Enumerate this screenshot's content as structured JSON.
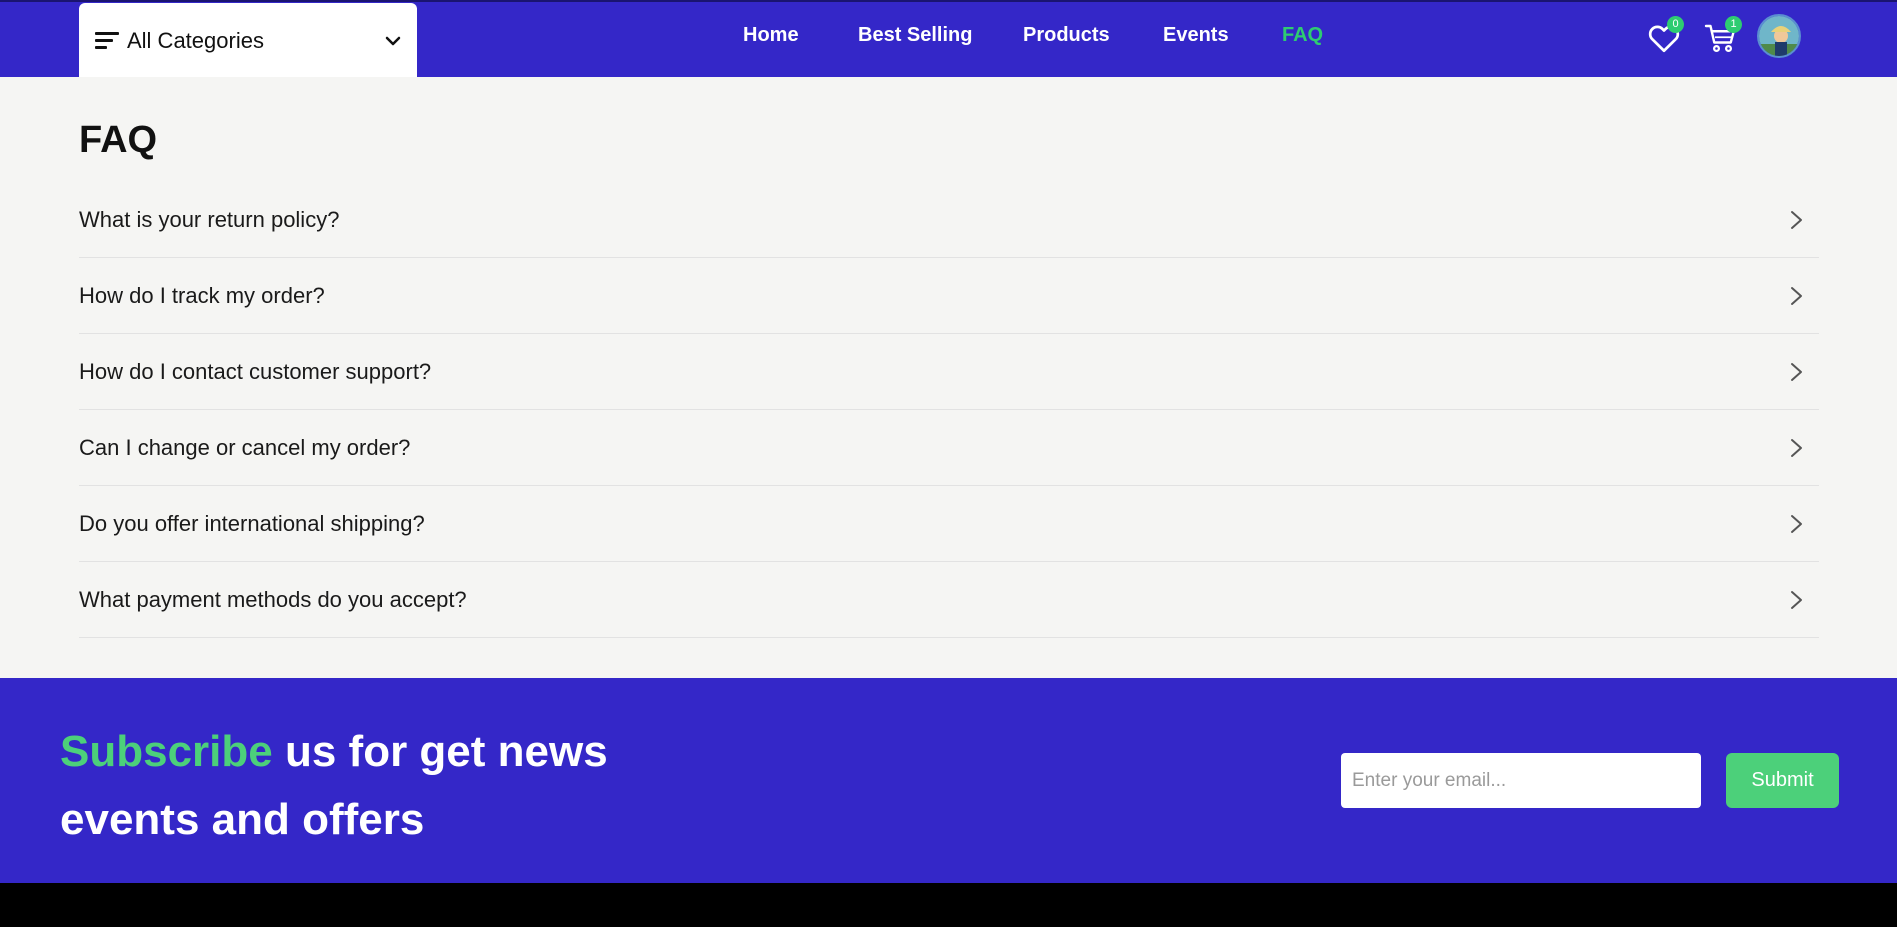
{
  "header": {
    "categories_label": "All Categories",
    "nav": [
      {
        "label": "Home",
        "active": false
      },
      {
        "label": "Best Selling",
        "active": false
      },
      {
        "label": "Products",
        "active": false
      },
      {
        "label": "Events",
        "active": false
      },
      {
        "label": "FAQ",
        "active": true
      }
    ],
    "wishlist_count": "0",
    "cart_count": "1",
    "icons": [
      "menu-icon",
      "chevron-down-icon",
      "heart-icon",
      "cart-icon",
      "avatar"
    ]
  },
  "faq": {
    "title": "FAQ",
    "items": [
      {
        "question": "What is your return policy?"
      },
      {
        "question": "How do I track my order?"
      },
      {
        "question": "How do I contact customer support?"
      },
      {
        "question": "Can I change or cancel my order?"
      },
      {
        "question": "Do you offer international shipping?"
      },
      {
        "question": "What payment methods do you accept?"
      }
    ]
  },
  "subscribe": {
    "accent_text": "Subscribe",
    "rest_text": " us for get news events and offers",
    "email_placeholder": "Enter your email...",
    "submit_label": "Submit"
  },
  "colors": {
    "brand": "#3427c8",
    "accent": "#2ecc71",
    "button": "#4cd07a",
    "page_bg": "#f5f5f3"
  }
}
